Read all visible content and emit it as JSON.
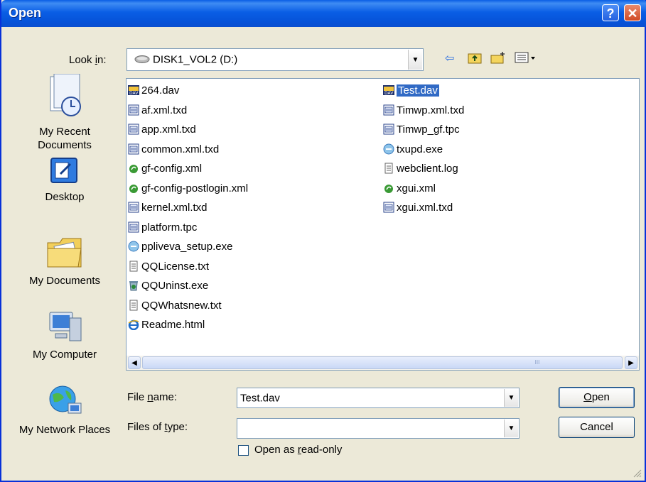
{
  "window": {
    "title": "Open",
    "help_glyph": "?",
    "close_glyph": "✕"
  },
  "lookin": {
    "label": "Look in:",
    "value": "DISK1_VOL2 (D:)"
  },
  "toolbar": {
    "back_glyph": "⇦",
    "up_glyph": "⮤",
    "newfolder_glyph": "✶",
    "views_glyph": "▦▾"
  },
  "places": [
    {
      "label": "My Recent Documents",
      "icon": "recent-documents-icon"
    },
    {
      "label": "Desktop",
      "icon": "desktop-icon"
    },
    {
      "label": "My Documents",
      "icon": "my-documents-icon"
    },
    {
      "label": "My Computer",
      "icon": "my-computer-icon"
    },
    {
      "label": "My Network Places",
      "icon": "network-places-icon"
    }
  ],
  "files": [
    {
      "name": "264.dav",
      "icon": "dav-file-icon"
    },
    {
      "name": "af.xml.txd",
      "icon": "txd-file-icon"
    },
    {
      "name": "app.xml.txd",
      "icon": "txd-file-icon"
    },
    {
      "name": "common.xml.txd",
      "icon": "txd-file-icon"
    },
    {
      "name": "gf-config.xml",
      "icon": "xml-file-icon"
    },
    {
      "name": "gf-config-postlogin.xml",
      "icon": "xml-file-icon"
    },
    {
      "name": "kernel.xml.txd",
      "icon": "txd-file-icon"
    },
    {
      "name": "platform.tpc",
      "icon": "txd-file-icon"
    },
    {
      "name": "ppliveva_setup.exe",
      "icon": "exe-file-icon"
    },
    {
      "name": "QQLicense.txt",
      "icon": "text-file-icon"
    },
    {
      "name": "QQUninst.exe",
      "icon": "uninstall-icon"
    },
    {
      "name": "QQWhatsnew.txt",
      "icon": "text-file-icon"
    },
    {
      "name": "Readme.html",
      "icon": "html-file-icon"
    },
    {
      "name": "Test.dav",
      "icon": "dav-file-icon",
      "selected": true
    },
    {
      "name": "Timwp.xml.txd",
      "icon": "txd-file-icon"
    },
    {
      "name": "Timwp_gf.tpc",
      "icon": "txd-file-icon"
    },
    {
      "name": "txupd.exe",
      "icon": "exe-file-icon"
    },
    {
      "name": "webclient.log",
      "icon": "text-file-icon"
    },
    {
      "name": "xgui.xml",
      "icon": "xml-file-icon"
    },
    {
      "name": "xgui.xml.txd",
      "icon": "txd-file-icon"
    }
  ],
  "scrollbar": {
    "left_glyph": "◀",
    "right_glyph": "▶",
    "grip": "III"
  },
  "filename": {
    "label_pre": "File ",
    "label_u": "n",
    "label_post": "ame:",
    "value": "Test.dav"
  },
  "filetype": {
    "label_pre": "Files of ",
    "label_u": "t",
    "label_post": "ype:",
    "value": ""
  },
  "open_button": {
    "u": "O",
    "rest": "pen"
  },
  "cancel_button": {
    "label": "Cancel"
  },
  "readonly": {
    "pre": "Open as ",
    "u": "r",
    "post": "ead-only",
    "checked": false
  },
  "colors": {
    "title_blue": "#0a5ee5",
    "dialog_bg": "#ece9d8",
    "selection": "#316ac5"
  }
}
